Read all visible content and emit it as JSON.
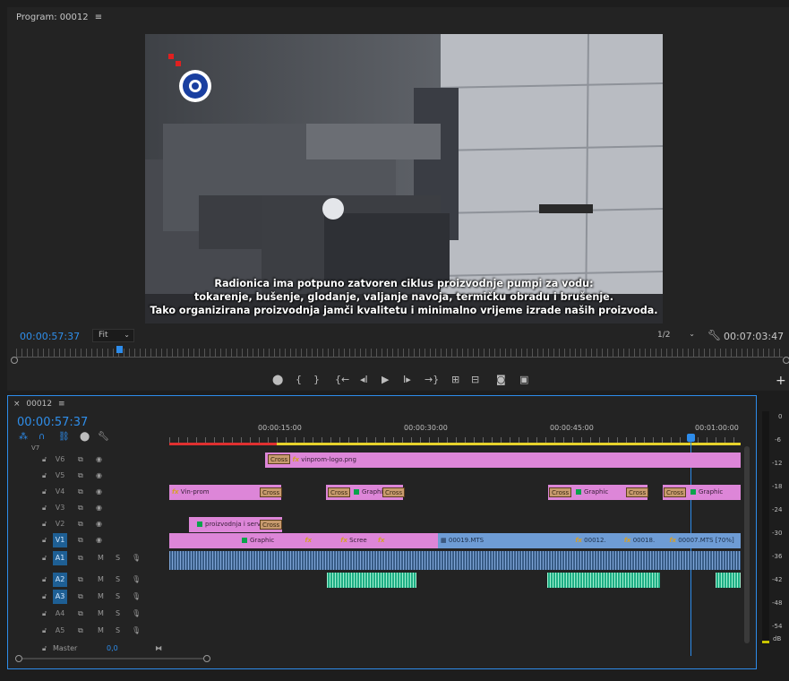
{
  "program": {
    "title": "Program: 00012",
    "timecode": "00:00:57:37",
    "fit": "Fit",
    "quality": "1/2",
    "duration": "00:07:03:47",
    "subtitle_lines": [
      "Radionica ima potpuno zatvoren ciklus proizvodnje pumpi za vodu:",
      "tokarenje, bušenje, glodanje, valjanje navoja, termičku obradu i brušenje.",
      "Tako organizirana proizvodnja jamči kvalitetu i minimalno vrijeme izrade naših proizvoda."
    ]
  },
  "transport_icons": [
    "marker-icon",
    "mark-in-icon",
    "mark-out-icon",
    "go-to-in-icon",
    "step-back-icon",
    "play-icon",
    "step-forward-icon",
    "go-to-out-icon",
    "lift-icon",
    "extract-icon",
    "export-frame-icon",
    "compare-icon"
  ],
  "timeline": {
    "tab": "00012",
    "timecode": "00:00:57:37",
    "ruler_labels": [
      "00:00:15:00",
      "00:00:30:00",
      "00:00:45:00",
      "00:01:00:00"
    ],
    "video_tracks": [
      {
        "id": "V7"
      },
      {
        "id": "V6"
      },
      {
        "id": "V5"
      },
      {
        "id": "V4"
      },
      {
        "id": "V3"
      },
      {
        "id": "V2"
      },
      {
        "id": "V1"
      }
    ],
    "audio_tracks": [
      {
        "id": "A1"
      },
      {
        "id": "A2"
      },
      {
        "id": "A3"
      },
      {
        "id": "A4"
      },
      {
        "id": "A5"
      }
    ],
    "master": {
      "label": "Master",
      "value": "0,0"
    },
    "clips": {
      "v6_logo": "vinprom-logo.png",
      "v4_vinprom": "Vin-prom",
      "graphic": "Graphic",
      "graphi_short": "Graphi",
      "cross": "Cross",
      "v2_title": "proizvodnja i servi",
      "v1_scree": "Scree",
      "v1_mts19": "00019.MTS",
      "v1_00012": "00012.",
      "v1_00018": "00018.",
      "v1_00007": "00007.MTS [70%]",
      "fx": "fx"
    },
    "track_letters": {
      "mute": "M",
      "solo": "S"
    }
  },
  "meter": {
    "labels": [
      "0",
      "-6",
      "-12",
      "-18",
      "-24",
      "-30",
      "-36",
      "-42",
      "-48",
      "-54",
      "dB"
    ]
  },
  "colors": {
    "accent": "#2d8ceb",
    "graphic_clip": "#dd86d8",
    "video_clip": "#6e9cd5",
    "audio_clip": "#1fae85"
  }
}
